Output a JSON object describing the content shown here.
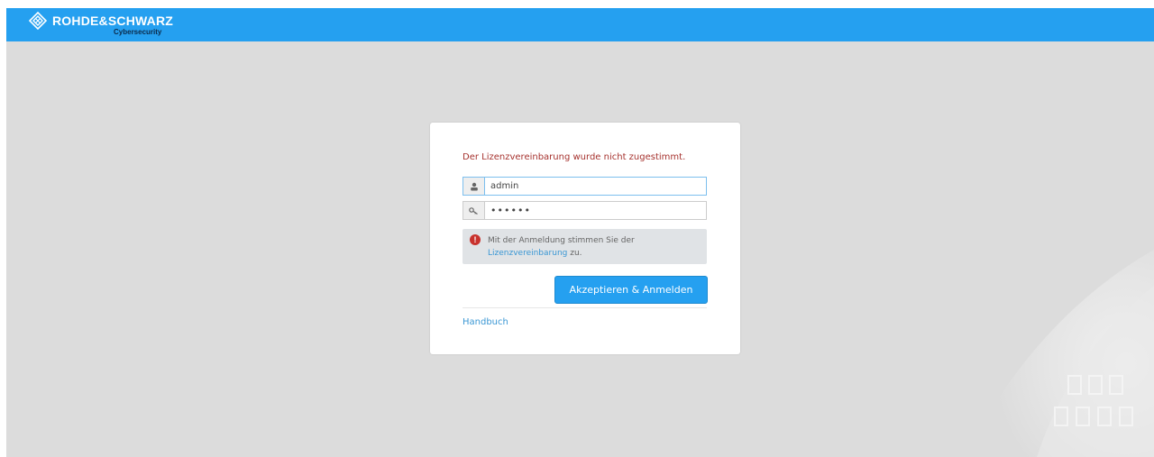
{
  "header": {
    "brand": "ROHDE&SCHWARZ",
    "subbrand": "Cybersecurity",
    "logo_icon": "rs-diamond-logo-icon",
    "background_color": "#25a0f0"
  },
  "login": {
    "error_message": "Der Lizenzvereinbarung wurde nicht zugestimmt.",
    "username_icon": "user-icon",
    "username_value": "admin",
    "password_icon": "key-icon",
    "password_value": "••••••",
    "notice_icon": "exclamation-icon",
    "notice_text_before": "Mit der Anmeldung stimmen Sie der",
    "notice_link": "Lizenzvereinbarung",
    "notice_text_after": " zu.",
    "submit_label": "Akzeptieren & Anmelden",
    "handbook_link": "Handbuch"
  },
  "colors": {
    "accent": "#25a0f0",
    "error": "#a6322e",
    "page_background": "#dcdcdc"
  }
}
